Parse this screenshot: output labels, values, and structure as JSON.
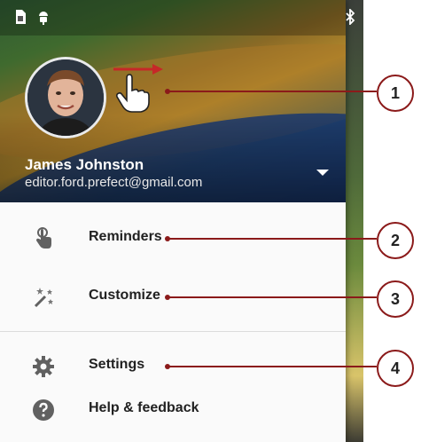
{
  "status_bar": {
    "icons": [
      "sim-card-icon",
      "android-icon",
      "bluetooth-icon"
    ]
  },
  "account": {
    "name": "James Johnston",
    "email": "editor.ford.prefect@gmail.com"
  },
  "menu": {
    "items": [
      {
        "label": "Reminders",
        "icon": "reminder-hand-icon"
      },
      {
        "label": "Customize",
        "icon": "magic-wand-icon"
      },
      {
        "label": "Settings",
        "icon": "gear-icon"
      },
      {
        "label": "Help & feedback",
        "icon": "help-icon"
      }
    ]
  },
  "callouts": [
    "1",
    "2",
    "3",
    "4"
  ],
  "colors": {
    "callout": "#8b1a1a",
    "hint_arrow": "#c62828",
    "header_blue": "#1f3f7a"
  }
}
